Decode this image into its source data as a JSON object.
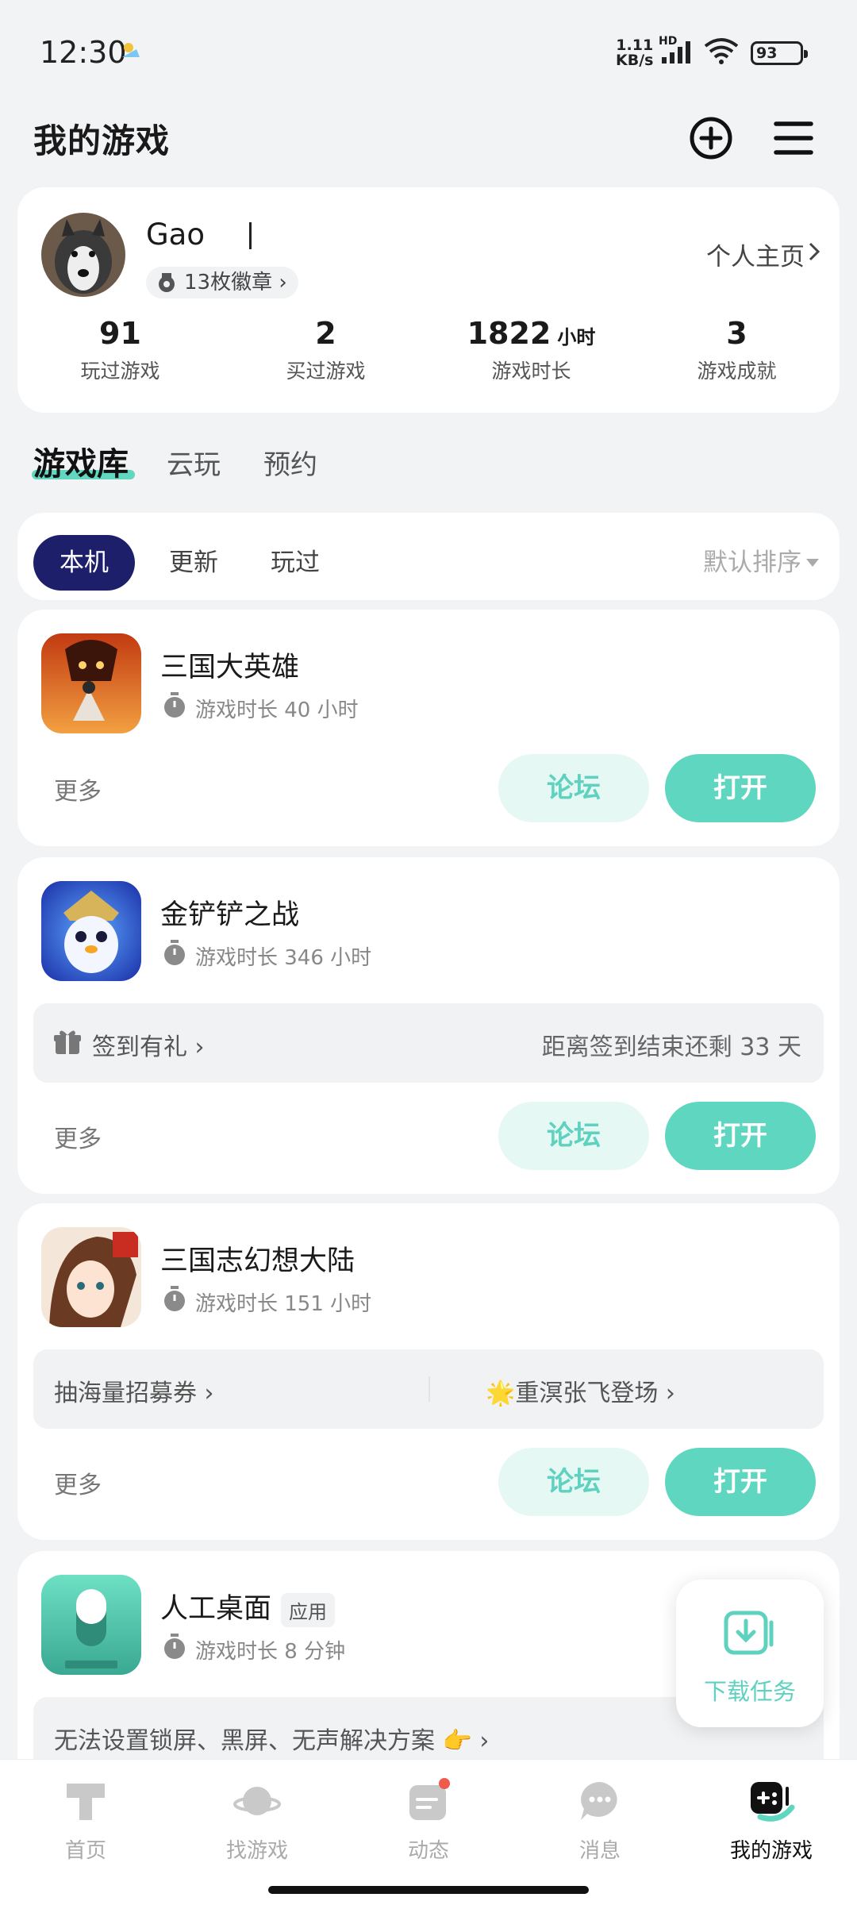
{
  "status": {
    "time": "12:30",
    "speed": "1.11",
    "speed_unit": "KB/s",
    "hd": "HD",
    "battery": "93"
  },
  "header": {
    "title": "我的游戏",
    "add_icon": "plus-circle-icon",
    "menu_icon": "menu-icon"
  },
  "profile": {
    "name": "Gao",
    "badges": "13枚徽章",
    "homepage": "个人主页",
    "stats": [
      {
        "value": "91",
        "unit": "",
        "label": "玩过游戏"
      },
      {
        "value": "2",
        "unit": "",
        "label": "买过游戏"
      },
      {
        "value": "1822",
        "unit": "小时",
        "label": "游戏时长"
      },
      {
        "value": "3",
        "unit": "",
        "label": "游戏成就"
      }
    ]
  },
  "tabs": [
    "游戏库",
    "云玩",
    "预约"
  ],
  "filters": {
    "chips": [
      "本机",
      "更新",
      "玩过"
    ],
    "sort": "默认排序"
  },
  "games": [
    {
      "name": "三国大英雄",
      "time": "游戏时长 40 小时",
      "more": "更多",
      "forum": "论坛",
      "open": "打开"
    },
    {
      "name": "金铲铲之战",
      "time": "游戏时长 346 小时",
      "more": "更多",
      "forum": "论坛",
      "open": "打开",
      "strip_left": "签到有礼",
      "strip_right": "距离签到结束还剩 33 天"
    },
    {
      "name": "三国志幻想大陆",
      "time": "游戏时长 151 小时",
      "more": "更多",
      "forum": "论坛",
      "open": "打开",
      "strip_left": "抽海量招募券",
      "strip_right": "🌟重溟张飞登场"
    },
    {
      "name": "人工桌面",
      "tag": "应用",
      "time": "游戏时长 8 分钟",
      "strip_left": "无法设置锁屏、黑屏、无声解决方案 👉"
    }
  ],
  "float": {
    "label": "下载任务"
  },
  "nav": [
    {
      "label": "首页",
      "icon": "home-icon"
    },
    {
      "label": "找游戏",
      "icon": "planet-icon"
    },
    {
      "label": "动态",
      "icon": "feed-icon"
    },
    {
      "label": "消息",
      "icon": "chat-icon"
    },
    {
      "label": "我的游戏",
      "icon": "gamepad-icon"
    }
  ],
  "colors": {
    "accent": "#5fd6c0",
    "active_chip": "#1e1f6b",
    "background": "#f2f3f5"
  }
}
